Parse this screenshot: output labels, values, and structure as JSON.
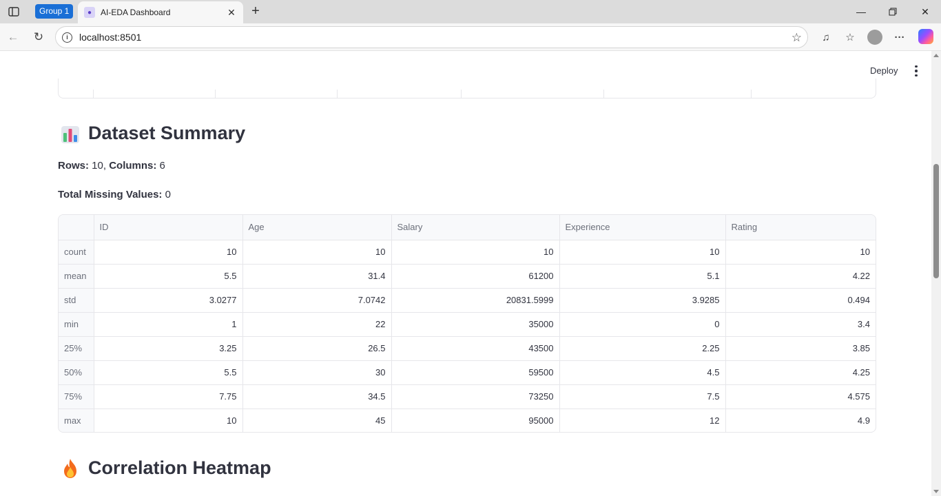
{
  "browser": {
    "tab_group_label": "Group 1",
    "tab_title": "AI-EDA Dashboard",
    "url": "localhost:8501"
  },
  "app": {
    "deploy_label": "Deploy"
  },
  "summary": {
    "title": "Dataset Summary",
    "rows_label": "Rows:",
    "rows_value": "10",
    "columns_label": "Columns:",
    "columns_value": "6",
    "missing_label": "Total Missing Values:",
    "missing_value": "0"
  },
  "stats_table": {
    "columns": [
      "",
      "ID",
      "Age",
      "Salary",
      "Experience",
      "Rating"
    ],
    "rows": [
      [
        "count",
        "10",
        "10",
        "10",
        "10",
        "10"
      ],
      [
        "mean",
        "5.5",
        "31.4",
        "61200",
        "5.1",
        "4.22"
      ],
      [
        "std",
        "3.0277",
        "7.0742",
        "20831.5999",
        "3.9285",
        "0.494"
      ],
      [
        "min",
        "1",
        "22",
        "35000",
        "0",
        "3.4"
      ],
      [
        "25%",
        "3.25",
        "26.5",
        "43500",
        "2.25",
        "3.85"
      ],
      [
        "50%",
        "5.5",
        "30",
        "59500",
        "4.5",
        "4.25"
      ],
      [
        "75%",
        "7.75",
        "34.5",
        "73250",
        "7.5",
        "4.575"
      ],
      [
        "max",
        "10",
        "45",
        "95000",
        "12",
        "4.9"
      ]
    ]
  },
  "heatmap": {
    "title": "Correlation Heatmap"
  },
  "icons": [
    "sidebar-toggle-icon",
    "close-icon",
    "plus-icon",
    "minimize-icon",
    "restore-icon",
    "back-icon",
    "reload-icon",
    "info-icon",
    "star-icon",
    "read-aloud-icon",
    "favorites-icon",
    "profile-icon",
    "more-icon",
    "copilot-icon",
    "bar-chart-emoji-icon",
    "fire-emoji-icon",
    "kebab-menu-icon"
  ],
  "colors": {
    "tab_group": "#1a6fd6",
    "text": "#31333f",
    "border": "#e6e6ea",
    "header_bg": "#f8f9fb"
  }
}
